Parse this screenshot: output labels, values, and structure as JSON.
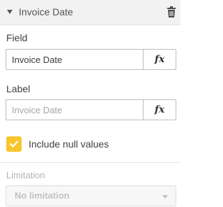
{
  "header": {
    "title": "Invoice Date",
    "collapse_icon": "caret-down-icon",
    "delete_icon": "trash-icon"
  },
  "field": {
    "label": "Field",
    "value": "Invoice Date",
    "expression_button": "fx"
  },
  "label_section": {
    "label": "Label",
    "placeholder": "Invoice Date",
    "expression_button": "fx"
  },
  "null_values": {
    "label": "Include null values",
    "checked": true,
    "check_color": "#f8c52c"
  },
  "limitation": {
    "label": "Limitation",
    "selected": "No limitation",
    "disabled": true
  }
}
